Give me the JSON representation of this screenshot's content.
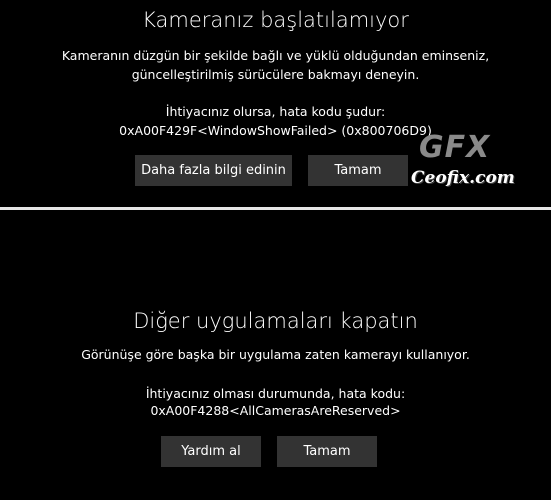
{
  "top_dialog": {
    "title": "Kameranız başlatılamıyor",
    "message_line1": "Kameranın düzgün bir şekilde bağlı ve yüklü olduğundan eminseniz,",
    "message_line2": "güncelleştirilmiş sürücülere bakmayı deneyin.",
    "error_intro": "İhtiyacınız olursa, hata kodu şudur:",
    "error_code": "0xA00F429F<WindowShowFailed> (0x800706D9)",
    "more_info_label": "Daha fazla bilgi edinin",
    "ok_label": "Tamam"
  },
  "bottom_dialog": {
    "title": "Diğer uygulamaları kapatın",
    "message": "Görünüşe göre başka bir uygulama zaten kamerayı kullanıyor.",
    "error_intro": "İhtiyacınız olması durumunda, hata kodu:",
    "error_code": "0xA00F4288<AllCamerasAreReserved>",
    "help_label": "Yardım al",
    "ok_label": "Tamam"
  },
  "watermark": {
    "logo": "GFX",
    "text": "Ceofix.com"
  },
  "colors": {
    "background": "#000000",
    "button": "#333333",
    "divider": "#e6e6e6",
    "text": "#ffffff"
  }
}
